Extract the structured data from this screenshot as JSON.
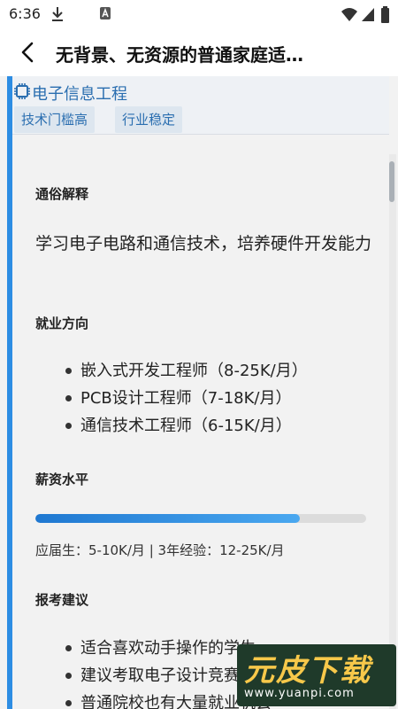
{
  "status_bar": {
    "time": "6:36",
    "icons": [
      "download-icon",
      "a-badge-icon",
      "wifi-icon",
      "signal-icon",
      "battery-icon"
    ]
  },
  "app_bar": {
    "title": "无背景、无资源的普通家庭适…",
    "back_icon": "chevron-left-icon"
  },
  "card": {
    "major_icon": "chip-icon",
    "major_name": "电子信息工程",
    "tags": [
      "技术门槛高",
      "行业稳定"
    ],
    "accent_color": "#2d8de3"
  },
  "sections": {
    "explain_title": "通俗解释",
    "explain_text": "学习电子电路和通信技术，培养硬件开发能力",
    "jobs_title": "就业方向",
    "jobs": [
      "嵌入式开发工程师（8-25K/月）",
      "PCB设计工程师（7-18K/月）",
      "通信技术工程师（6-15K/月）"
    ],
    "salary_title": "薪资水平",
    "salary_progress_percent": 80,
    "salary_note": "应届生：5-10K/月 | 3年经验：12-25K/月",
    "advice_title": "报考建议",
    "advice": [
      "适合喜欢动手操作的学生",
      "建议考取电子设计竞赛",
      "普通院校也有大量就业机会"
    ]
  },
  "watermark": {
    "text": "元皮下载",
    "url": "www.yuanpi.com"
  }
}
